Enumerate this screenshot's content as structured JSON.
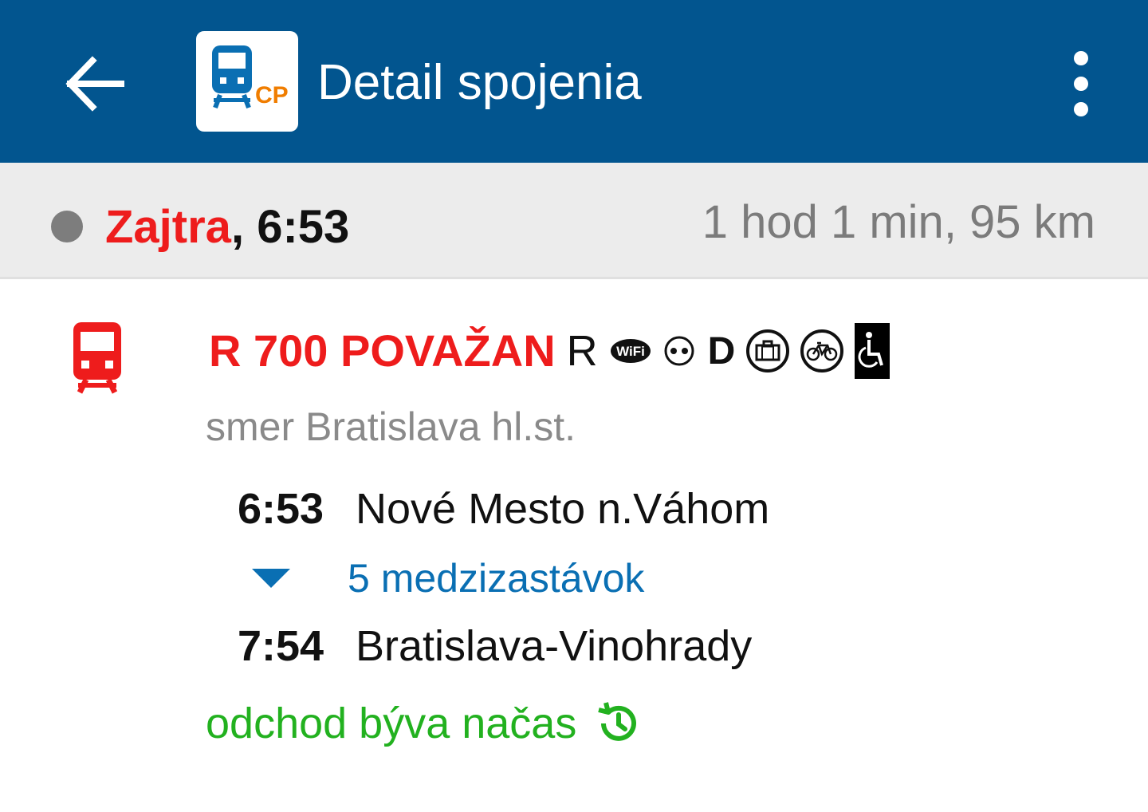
{
  "colors": {
    "appbar": "#02558f",
    "accent_red": "#ee1c1c",
    "link_blue": "#0a6fb3",
    "ok_green": "#22b11f",
    "muted_gray": "#7b7b7b"
  },
  "appbar": {
    "title": "Detail spojenia",
    "back_icon": "arrow-left-icon",
    "logo_text": "CP",
    "menu_icon": "more-vert-icon"
  },
  "summary": {
    "day": "Zajtra",
    "separator": ", ",
    "time": "6:53",
    "duration": "1 hod 1 min, 95 km"
  },
  "connection": {
    "train_name": "R 700 POVAŽAN",
    "category": "R",
    "features": {
      "wifi_text": "WiFi",
      "d_text": "D",
      "icons": [
        "wifi-icon",
        "seat-reservation-icon",
        "dining-car-icon",
        "luggage-icon",
        "bicycle-icon",
        "wheelchair-icon"
      ]
    },
    "direction": "smer Bratislava hl.st.",
    "departure": {
      "time": "6:53",
      "station": "Nové Mesto n.Váhom"
    },
    "intermediate_stops": "5 medzizastávok",
    "arrival": {
      "time": "7:54",
      "station": "Bratislava-Vinohrady"
    },
    "punctuality": "odchod býva načas"
  }
}
